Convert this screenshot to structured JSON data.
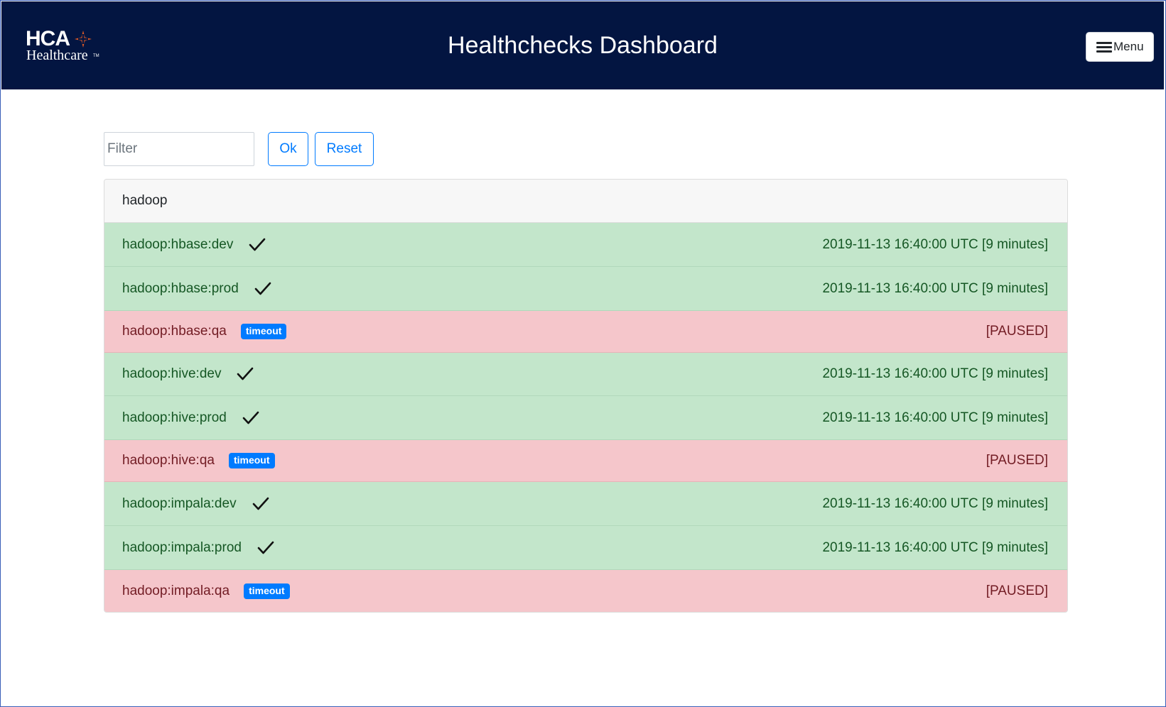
{
  "header": {
    "logo": {
      "primary": "HCA",
      "secondary": "Healthcare",
      "trademark": "TM",
      "cross_color": "#e05a26"
    },
    "title": "Healthchecks Dashboard",
    "menu_label": "Menu"
  },
  "filter": {
    "placeholder": "Filter",
    "value": "",
    "ok_label": "Ok",
    "reset_label": "Reset"
  },
  "group": {
    "title": "hadoop",
    "rows": [
      {
        "name": "hadoop:hbase:dev",
        "status": "ok",
        "badge": "",
        "right": "2019-11-13 16:40:00 UTC [9 minutes]"
      },
      {
        "name": "hadoop:hbase:prod",
        "status": "ok",
        "badge": "",
        "right": "2019-11-13 16:40:00 UTC [9 minutes]"
      },
      {
        "name": "hadoop:hbase:qa",
        "status": "fail",
        "badge": "timeout",
        "right": "[PAUSED]"
      },
      {
        "name": "hadoop:hive:dev",
        "status": "ok",
        "badge": "",
        "right": "2019-11-13 16:40:00 UTC [9 minutes]"
      },
      {
        "name": "hadoop:hive:prod",
        "status": "ok",
        "badge": "",
        "right": "2019-11-13 16:40:00 UTC [9 minutes]"
      },
      {
        "name": "hadoop:hive:qa",
        "status": "fail",
        "badge": "timeout",
        "right": "[PAUSED]"
      },
      {
        "name": "hadoop:impala:dev",
        "status": "ok",
        "badge": "",
        "right": "2019-11-13 16:40:00 UTC [9 minutes]"
      },
      {
        "name": "hadoop:impala:prod",
        "status": "ok",
        "badge": "",
        "right": "2019-11-13 16:40:00 UTC [9 minutes]"
      },
      {
        "name": "hadoop:impala:qa",
        "status": "fail",
        "badge": "timeout",
        "right": "[PAUSED]"
      }
    ]
  },
  "colors": {
    "header_bg": "#031541",
    "ok_bg": "#c3e6cb",
    "ok_text": "#155724",
    "fail_bg": "#f5c6cb",
    "fail_text": "#721c24",
    "accent": "#007bff"
  }
}
